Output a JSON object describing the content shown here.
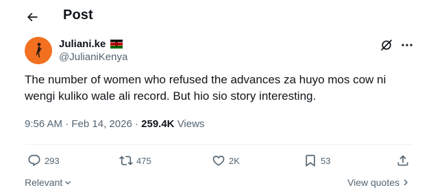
{
  "header": {
    "title": "Post",
    "back_icon": "arrow-left-icon"
  },
  "author": {
    "name": "Juliani.ke",
    "handle": "@JulianiKenya",
    "flag_icon": "kenya-flag-icon",
    "avatar_color": "#f37021"
  },
  "tweet": {
    "text": "The number of women who refused the advances za huyo mos cow ni wengi kuliko wale ali record. But hio sio story interesting.",
    "time": "9:56 AM",
    "separator": "·",
    "date": "Feb 14, 2026",
    "views_count": "259.4K",
    "views_label": "Views"
  },
  "actions": {
    "replies": "293",
    "reposts": "475",
    "likes": "2K",
    "bookmarks": "53"
  },
  "footer": {
    "sort_label": "Relevant",
    "view_quotes_label": "View quotes"
  },
  "colors": {
    "text_primary": "#0f1419",
    "text_secondary": "#536471",
    "divider": "#eff3f4"
  }
}
